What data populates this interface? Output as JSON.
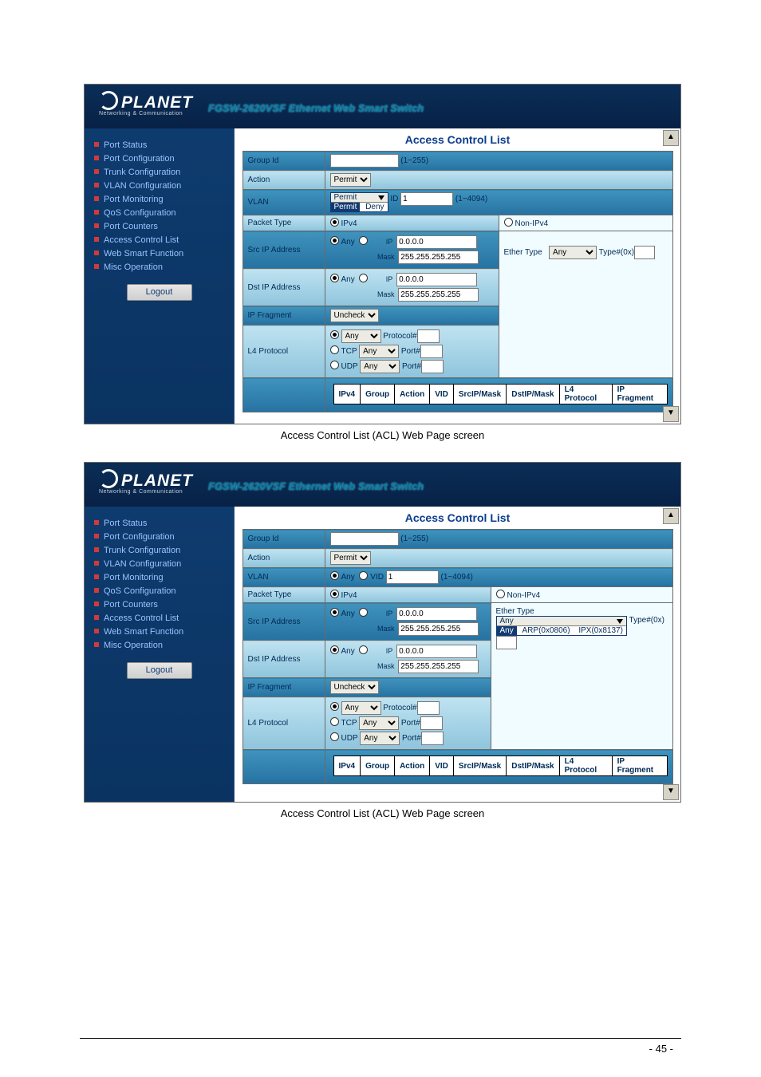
{
  "logo_text": "PLANET",
  "logo_sub": "Networking & Communication",
  "banner_subtitle": "FGSW-2620VSF Ethernet Web Smart Switch",
  "menu": [
    "Port Status",
    "Port Configuration",
    "Trunk Configuration",
    "VLAN Configuration",
    "Port Monitoring",
    "QoS Configuration",
    "Port Counters",
    "Access Control List",
    "Web Smart Function",
    "Misc Operation"
  ],
  "logout_label": "Logout",
  "page_title": "Access Control List",
  "caption1": "Access Control List (ACL) Web Page screen",
  "caption2": "Access Control List (ACL) Web Page screen",
  "page_number": "- 45 -",
  "labels": {
    "group_id": "Group Id",
    "action": "Action",
    "vlan": "VLAN",
    "packet_type": "Packet Type",
    "src_ip": "Src IP Address",
    "dst_ip": "Dst IP Address",
    "ip_frag": "IP Fragment",
    "l4": "L4 Protocol",
    "ether_type": "Ether Type"
  },
  "hints": {
    "group_range": "(1~255)",
    "vlan_range": "(1~4094)"
  },
  "values": {
    "action_selected": "Permit",
    "action_options": [
      "Permit",
      "Deny"
    ],
    "vlan_id": "1",
    "ip_zero": "0.0.0.0",
    "mask_full": "255.255.255.255",
    "ipfrag_selected": "Uncheck",
    "type_hex": "Type#(0x)",
    "ether_selected": "Any",
    "ether_options": [
      "Any",
      "ARP(0x0806)",
      "IPX(0x8137)"
    ]
  },
  "radio": {
    "any": "Any",
    "ip": "IP",
    "vid": "VID",
    "ipv4": "IPv4",
    "nonipv4": "Non-IPv4",
    "mask": "Mask",
    "tcp": "TCP",
    "udp": "UDP",
    "protocol_num": "Protocol#",
    "port_num": "Port#"
  },
  "table_headers": [
    "IPv4",
    "Group",
    "Action",
    "VID",
    "SrcIP/Mask",
    "DstIP/Mask",
    "L4 Protocol",
    "IP Fragment"
  ]
}
